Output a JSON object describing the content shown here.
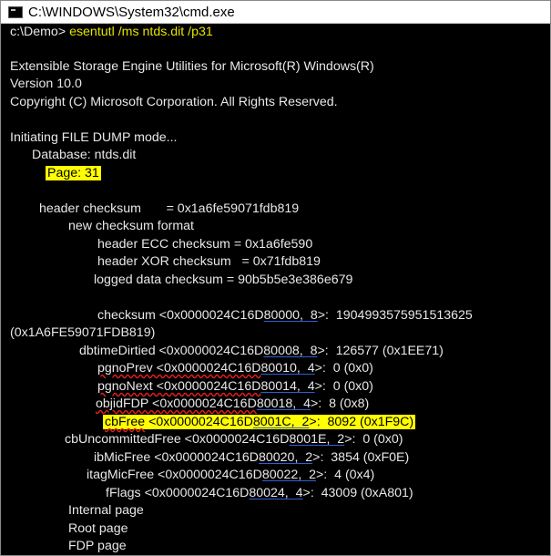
{
  "window": {
    "title": "C:\\WINDOWS\\System32\\cmd.exe"
  },
  "console": {
    "prompt": "c:\\Demo>",
    "command": "esentutl /ms ntds.dit /p31",
    "banner": [
      "Extensible Storage Engine Utilities for Microsoft(R) Windows(R)",
      "Version 10.0",
      "Copyright (C) Microsoft Corporation. All Rights Reserved."
    ],
    "mode": "Initiating FILE DUMP mode...",
    "database": "Database: ntds.dit",
    "page": "Page: 31",
    "header_checksum": "header checksum       = 0x1a6fe59071fdb819",
    "new_format": "new checksum format",
    "ecc": "header ECC checksum = 0x1a6fe590",
    "xor": "header XOR checksum   = 0x71fdb819",
    "logged": "logged data checksum = 90b5b5e3e386e679",
    "fields": {
      "checksum_pre": "checksum <0x0000024C16D",
      "checksum_ul": "80000,  8",
      "checksum_post": ">:  1904993575951513625",
      "checksum_wrap": "(0x1A6FE59071FDB819)",
      "dbtime_pre": "dbtimeDirtied <0x0000024C16D",
      "dbtime_ul": "80008,  8",
      "dbtime_post": ">:  126577 (0x1EE71)",
      "pgnoprev_pre": "pgnoPrev <0x0000024C16D",
      "pgnoprev_ul": "80010,  4",
      "pgnoprev_post": ">:  0 (0x0)",
      "pgnonext_pre": "pgnoNext <0x0000024C16D",
      "pgnonext_ul": "80014,  4",
      "pgnonext_post": ">:  0 (0x0)",
      "objid_pre": "objidFDP <0x0000024C16D",
      "objid_ul": "80018,  4",
      "objid_post": ">:  8 (0x8)",
      "cbfree_name": "cbFree",
      "cbfree_mid": " <0x0000024C16D",
      "cbfree_ul": "8001C,  2",
      "cbfree_post": ">:  8092 (0x1F9C)",
      "cbunc_pre": "cbUncommittedFree <0x0000024C16D",
      "cbunc_ul": "8001E,  2",
      "cbunc_post": ">:  0 (0x0)",
      "ibmic_pre": "ibMicFree <0x0000024C16D",
      "ibmic_ul": "80020,  2",
      "ibmic_post": ">:  3854 (0xF0E)",
      "itag_pre": "itagMicFree <0x0000024C16D",
      "itag_ul": "80022,  2",
      "itag_post": ">:  4 (0x4)",
      "fflags_pre": "fFlags <0x0000024C16D",
      "fflags_ul": "80024,  4",
      "fflags_post": ">:  43009 (0xA801)"
    },
    "page_types": [
      "Internal page",
      "Root page",
      "FDP page"
    ]
  }
}
